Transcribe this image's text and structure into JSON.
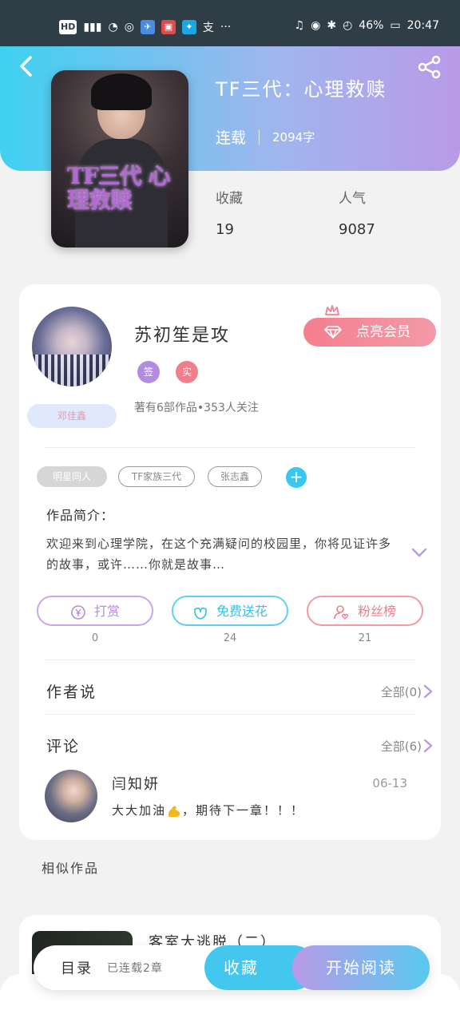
{
  "status_bar": {
    "left_icons": [
      "hd-icon",
      "4g-signal-icon",
      "wifi-icon",
      "weibo-icon",
      "app-icon-blue",
      "app-icon-red",
      "app-icon-bulb",
      "alipay-icon"
    ],
    "more": "···",
    "battery": "46%",
    "time": "20:47"
  },
  "book": {
    "title": "TF三代：心理救赎",
    "status": "连载",
    "word_count": "2094字",
    "cover_title": "TF三代 心理救赎"
  },
  "stats": {
    "favorites_label": "收藏",
    "favorites_value": "19",
    "popularity_label": "人气",
    "popularity_value": "9087"
  },
  "author": {
    "name": "苏初笙是攻",
    "badge_label": "邓佳鑫",
    "tag1": "签",
    "tag2": "实",
    "summary": "著有6部作品•353人关注",
    "vip_label": "点亮会员"
  },
  "tags": [
    "明星同人",
    "TF家族三代",
    "张志鑫"
  ],
  "intro": {
    "heading": "作品简介：",
    "text": "欢迎来到心理学院，在这个充满疑问的校园里，你将见证许多的故事，或许……你就是故事…"
  },
  "actions": {
    "tip_label": "打赏",
    "tip_count": "0",
    "flower_label": "免费送花",
    "flower_count": "24",
    "fans_label": "粉丝榜",
    "fans_count": "21"
  },
  "author_says": {
    "title": "作者说",
    "link": "全部(0)"
  },
  "comments": {
    "title": "评论",
    "link": "全部(6)",
    "items": [
      {
        "name": "闫知妍",
        "date": "06-13",
        "text_before": "大大加油",
        "text_after": "，期待下一章！！！"
      }
    ]
  },
  "similar": {
    "title": "相似作品",
    "first_name": "客室大逃脱（二）"
  },
  "bottom": {
    "toc_label": "目录",
    "toc_status": "已连载2章",
    "collect_label": "收藏",
    "read_label": "开始阅读"
  },
  "colors": {
    "accent_cyan": "#44c7ee",
    "accent_purple": "#b99ae8",
    "vip_pink": "#f47f8e"
  }
}
